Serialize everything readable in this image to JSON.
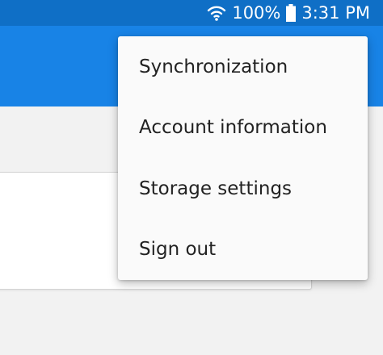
{
  "status_bar": {
    "battery_text": "100%",
    "time": "3:31 PM",
    "icons": [
      "wifi-icon",
      "battery-icon"
    ],
    "background": "#0f6fc6"
  },
  "app_bar": {
    "background": "#1883e6"
  },
  "overflow_menu": {
    "items": [
      {
        "label": "Synchronization"
      },
      {
        "label": "Account information"
      },
      {
        "label": "Storage settings"
      },
      {
        "label": "Sign out"
      }
    ]
  }
}
